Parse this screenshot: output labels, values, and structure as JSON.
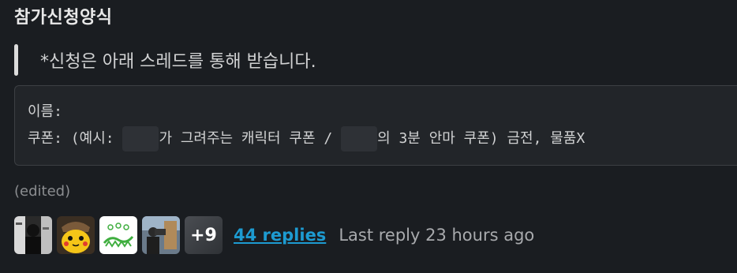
{
  "message": {
    "heading": "참가신청양식",
    "quote": "*신청은 아래 스레드를 통해 받습니다.",
    "code_lines": {
      "line1": "이름:",
      "line2_a": "쿠폰: (예시: ",
      "line2_b": "가 그려주는 캐릭터 쿠폰 / ",
      "line2_c": "의 3분 안마 쿠폰) 금전, 물품X"
    },
    "edited_label": "(edited)"
  },
  "thread": {
    "avatars": [
      {
        "icon": "person-photo-avatar"
      },
      {
        "icon": "pikachu-detective-avatar"
      },
      {
        "icon": "green-drawing-avatar"
      },
      {
        "icon": "camera-crew-avatar"
      }
    ],
    "more_count": "+9",
    "replies_label": "44 replies",
    "last_reply": "Last reply 23 hours ago"
  },
  "colors": {
    "background": "#1a1d21",
    "link": "#1d9bd1",
    "text": "#d1d2d3",
    "muted": "#a8aaad"
  }
}
